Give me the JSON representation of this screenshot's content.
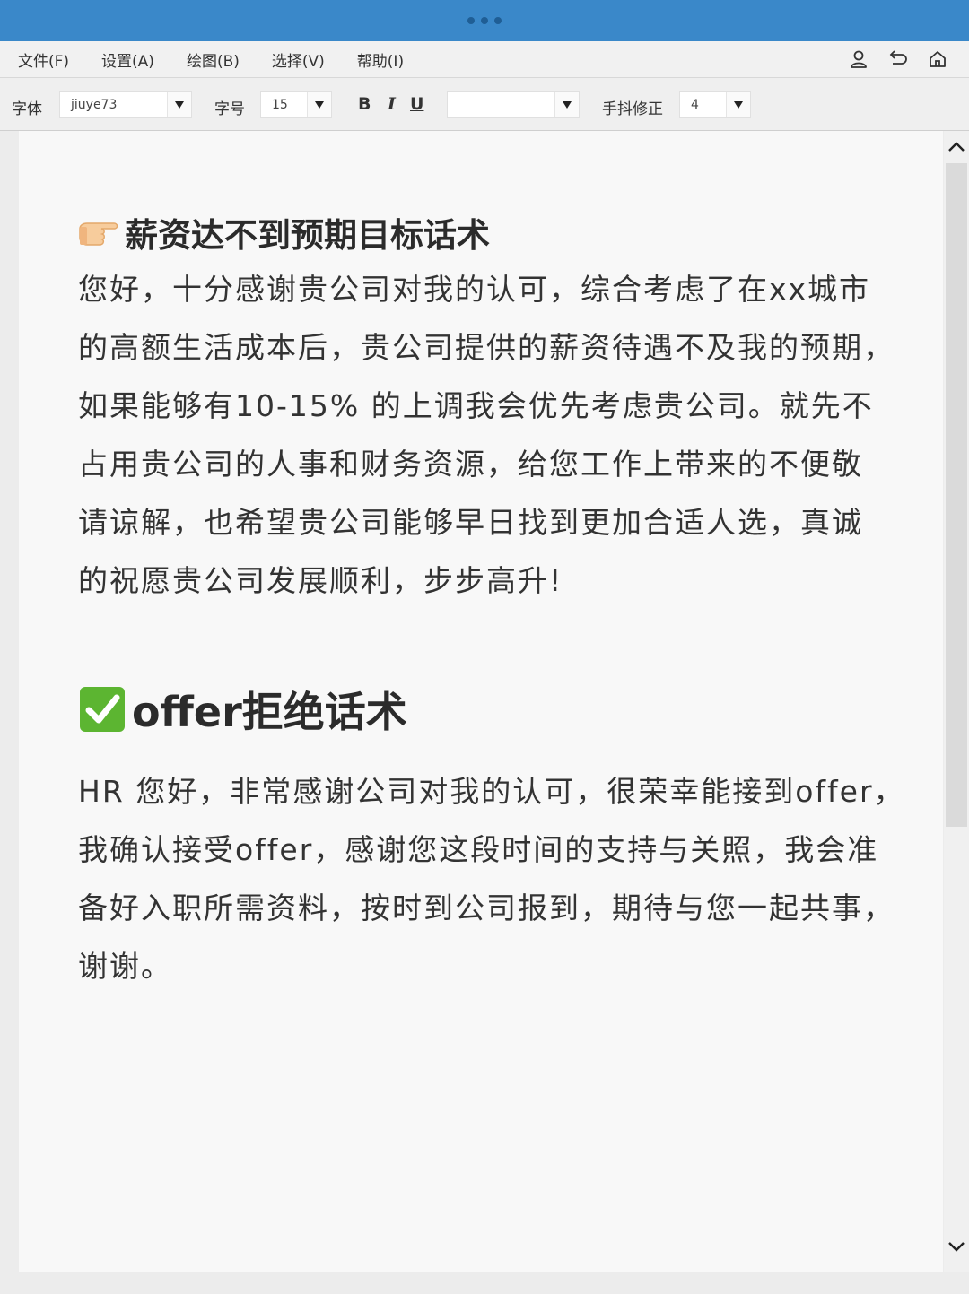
{
  "menubar": {
    "items": [
      "文件(F)",
      "设置(A)",
      "绘图(B)",
      "选择(V)",
      "帮助(I)"
    ],
    "icons": [
      "user-icon",
      "undo-icon",
      "home-icon"
    ]
  },
  "toolbar": {
    "font_label": "字体",
    "font_value": "jiuye73",
    "size_label": "字号",
    "size_value": "15",
    "bold": "B",
    "italic": "I",
    "underline": "U",
    "style_value": "",
    "shake_label": "手抖修正",
    "shake_value": "4"
  },
  "document": {
    "section1": {
      "title": "薪资达不到预期目标话术",
      "lines": [
        "您好，十分感谢贵公司对我的认可，综合考虑了在xx城市",
        "的高额生活成本后，贵公司提供的薪资待遇不及我的预期，",
        "如果能够有10-15% 的上调我会优先考虑贵公司。就先不",
        "占用贵公司的人事和财务资源，给您工作上带来的不便敬",
        "请谅解，也希望贵公司能够早日找到更加合适人选，真诚",
        "的祝愿贵公司发展顺利，步步高升!"
      ]
    },
    "section2": {
      "title": "offer拒绝话术",
      "lines": [
        "HR 您好，非常感谢公司对我的认可，很荣幸能接到offer，",
        "我确认接受offer，感谢您这段时间的支持与关照，我会准",
        "备好入职所需资料，按时到公司报到，期待与您一起共事，",
        "谢谢。"
      ]
    }
  },
  "colors": {
    "titlebar": "#3a88c9",
    "check_green": "#5cb531"
  }
}
